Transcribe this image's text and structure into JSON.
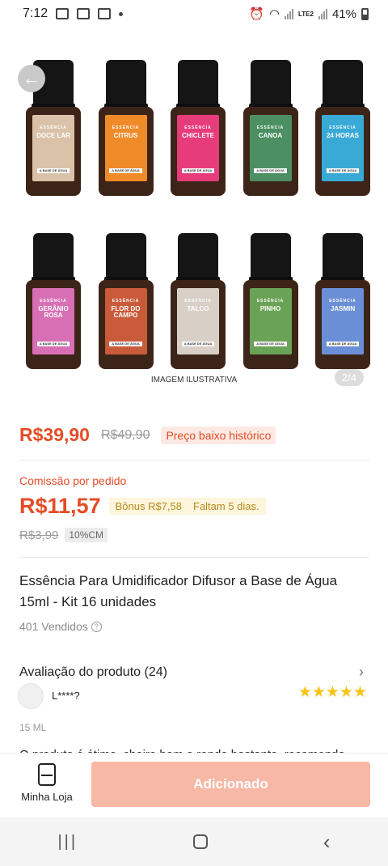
{
  "status_bar": {
    "time": "7:12",
    "battery": "41%",
    "network": "LTE2"
  },
  "gallery": {
    "bottles_row1": [
      {
        "name": "DOCE LAR",
        "color": "#d9c2a8"
      },
      {
        "name": "CITRUS",
        "color": "#f08b2a"
      },
      {
        "name": "CHICLETE",
        "color": "#e73c7c"
      },
      {
        "name": "CANOA",
        "color": "#4b8f62"
      },
      {
        "name": "24 HORAS",
        "color": "#39a9d6"
      }
    ],
    "bottles_row2": [
      {
        "name": "GERÂNIO ROSA",
        "color": "#d86fb4"
      },
      {
        "name": "FLOR DO CAMPO",
        "color": "#c95b3a"
      },
      {
        "name": "TALCO",
        "color": "#d8d0c6"
      },
      {
        "name": "PINHO",
        "color": "#6aa356"
      },
      {
        "name": "JASMIN",
        "color": "#6b8fd6"
      }
    ],
    "label_top": "ESSÊNCIA",
    "label_bottom": "A BASE DE ÁGUA",
    "caption": "IMAGEM ILUSTRATIVA",
    "counter": "2/4"
  },
  "pricing": {
    "price": "R$39,90",
    "old_price": "R$49,90",
    "tag": "Preço baixo histórico"
  },
  "commission": {
    "label": "Comissão por pedido",
    "value": "R$11,57",
    "bonus": "Bônus R$7,58",
    "remaining": "Faltam 5 dias.",
    "old_value": "R$3,99",
    "rate": "10%CM"
  },
  "product": {
    "title": "Essência Para Umidificador  Difusor a Base de Água 15ml - Kit 16 unidades",
    "sold": "401 Vendidos"
  },
  "review": {
    "heading": "Avaliação do produto (24)",
    "user": "L****?",
    "stars": "★★★★★",
    "variant": "15 ML",
    "snippet": "O produto é ótimo, cheiro bom e rende bastante, recomendo"
  },
  "bottom_bar": {
    "store_label": "Minha Loja",
    "add_label": "Adicionado"
  }
}
